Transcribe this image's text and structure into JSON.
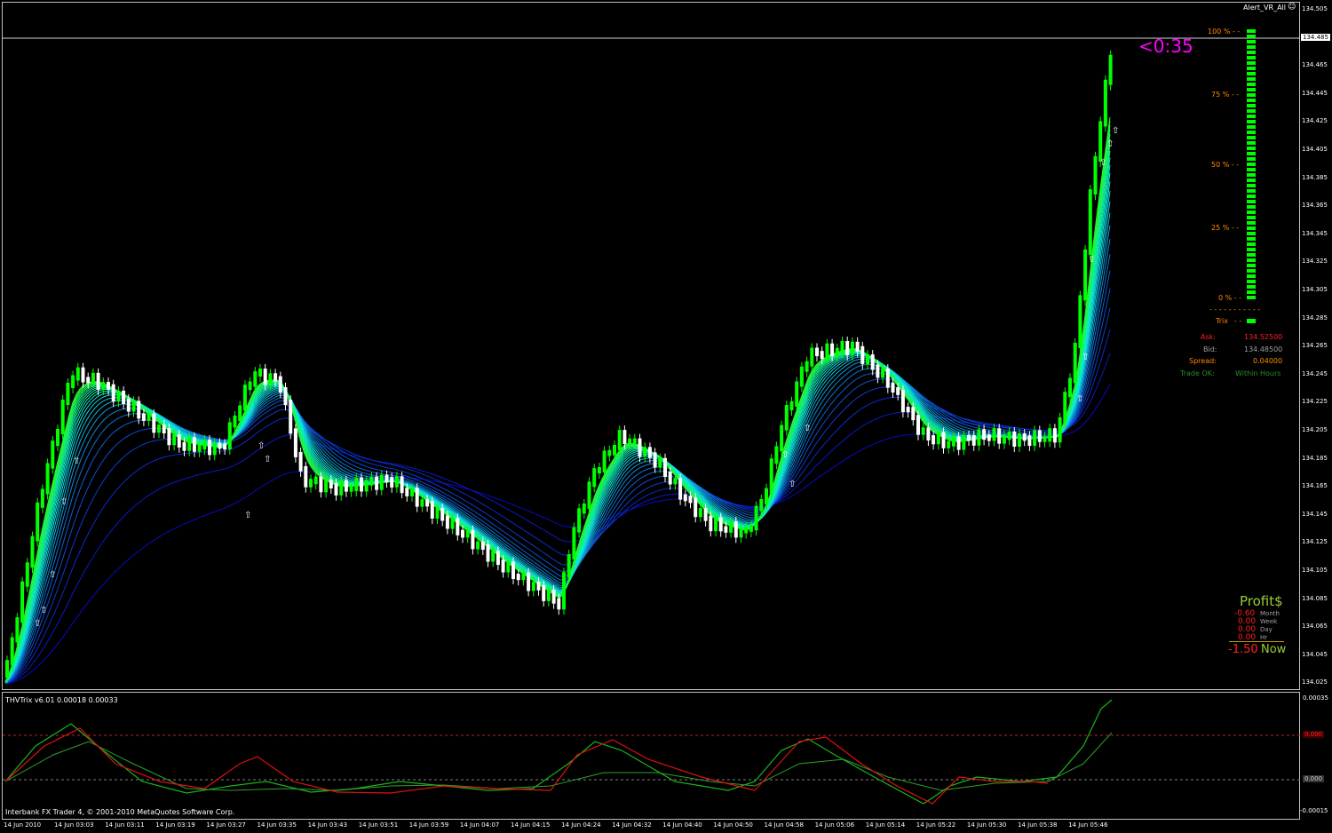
{
  "app": {
    "indicator_label": "Alert_VR_All",
    "copyright": "Interbank FX Trader 4, © 2001-2010 MetaQuotes Software Corp.",
    "countdown": "<0:35"
  },
  "price_axis": [
    "134.505",
    "134.485",
    "134.465",
    "134.445",
    "134.425",
    "134.405",
    "134.385",
    "134.365",
    "134.345",
    "134.325",
    "134.305",
    "134.285",
    "134.265",
    "134.245",
    "134.225",
    "134.205",
    "134.185",
    "134.165",
    "134.145",
    "134.125",
    "134.105",
    "134.085",
    "134.065",
    "134.045",
    "134.025"
  ],
  "current_price": "134.485",
  "time_axis": [
    "14 Jun 2010",
    "14 Jun 03:03",
    "14 Jun 03:11",
    "14 Jun 03:19",
    "14 Jun 03:27",
    "14 Jun 03:35",
    "14 Jun 03:43",
    "14 Jun 03:51",
    "14 Jun 03:59",
    "14 Jun 04:07",
    "14 Jun 04:15",
    "14 Jun 04:24",
    "14 Jun 04:32",
    "14 Jun 04:40",
    "14 Jun 04:50",
    "14 Jun 04:58",
    "14 Jun 05:06",
    "14 Jun 05:14",
    "14 Jun 05:22",
    "14 Jun 05:30",
    "14 Jun 05:38",
    "14 Jun 05:46"
  ],
  "gauge": {
    "levels": [
      "100 %",
      "75 %",
      "50 %",
      "25 %",
      "0 %"
    ],
    "value_pct": 100,
    "trix_label": "Trix"
  },
  "info": {
    "ask_label": "Ask:",
    "ask_value": "134.52500",
    "bid_label": "Bid:",
    "bid_value": "134.48500",
    "spread_label": "Spread:",
    "spread_value": "0.04000",
    "trade_label": "Trade OK:",
    "trade_value": "Within Hours"
  },
  "profit": {
    "title": "Profit$",
    "rows": [
      {
        "value": "-0.60",
        "label": "Month"
      },
      {
        "value": "0.00",
        "label": "Week"
      },
      {
        "value": "0.00",
        "label": "Day"
      },
      {
        "value": "0.00",
        "label": "Hr"
      }
    ],
    "now_value": "-1.50",
    "now_label": "Now"
  },
  "subchart": {
    "title": "THVTrix v6.01 0.00018 0.00033",
    "axis_top": "0.00035",
    "level_red": "0.000",
    "level_gray": "0.000",
    "axis_bottom": "-0.00015"
  },
  "colors": {
    "bull": "#00ff00",
    "bear": "#ffffff",
    "countdown": "#ff00ff",
    "orange": "#ff8a00",
    "profit_title": "#9acd32",
    "ask": "#ff2020",
    "bid": "#a0a0a0",
    "trade_ok": "#2e8b2e"
  }
}
